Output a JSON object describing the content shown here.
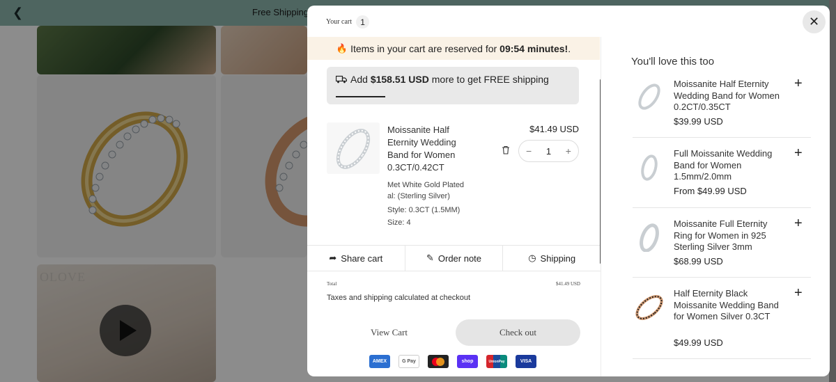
{
  "background": {
    "announcement": "Free Shipping",
    "watermark": "OLOVE"
  },
  "cart": {
    "title": "Your cart",
    "count": "1",
    "reserve_prefix": "Items in your cart are reserved for",
    "reserve_time": "09:54 minutes!",
    "reserve_suffix": ".",
    "shipping_prefix": "Add",
    "shipping_amount": "$158.51 USD",
    "shipping_suffix": "more to get FREE shipping",
    "shipping_progress_fraction": 0.21,
    "item": {
      "title": "Moissanite Half Eternity Wedding Band for Women 0.3CT/0.42CT",
      "options": [
        {
          "label": "Met White Gold Plated",
          "line2": "al:  (Sterling Silver)"
        },
        {
          "label": "Style:  0.3CT (1.5MM)"
        },
        {
          "label": "Size:  4"
        }
      ],
      "price": "$41.49 USD",
      "quantity": "1",
      "minus": "−",
      "plus": "+"
    },
    "actions": {
      "share": "Share cart",
      "note": "Order note",
      "shipping": "Shipping"
    },
    "total_label": "Total",
    "total_value": "$41.49 USD",
    "taxes_note": "Taxes and shipping calculated at checkout",
    "view_cart": "View Cart",
    "checkout": "Check out",
    "payments": [
      {
        "name": "AMEX",
        "color": "#2b6fd1"
      },
      {
        "name": "G Pay",
        "color": "#ffffff"
      },
      {
        "name": "MC",
        "color": "#222222"
      },
      {
        "name": "shop",
        "color": "#5a31f4"
      },
      {
        "name": "UnionPay",
        "color": "#d4252c"
      },
      {
        "name": "VISA",
        "color": "#1a3a9c"
      }
    ]
  },
  "recommendations": {
    "title": "You'll love this too",
    "items": [
      {
        "title": "Moissanite Half Eternity Wedding Band for Women 0.2CT/0.35CT",
        "price": "$39.99 USD",
        "metal": "silver"
      },
      {
        "title": "Full Moissanite Wedding Band for Women 1.5mm/2.0mm",
        "price": "From $49.99 USD",
        "metal": "silver"
      },
      {
        "title": "Moissanite Full Eternity Ring for Women in 925 Sterling Silver 3mm",
        "price": "$68.99 USD",
        "metal": "silver"
      },
      {
        "title": "Half Eternity Black Moissanite Wedding Band for Women Silver 0.3CT",
        "price": "$49.99 USD",
        "metal": "rose-black"
      }
    ]
  },
  "icons": {
    "back": "chevron-left-icon",
    "close": "close-icon",
    "fire": "fire-icon",
    "truck": "truck-icon",
    "trash": "trash-icon",
    "share": "share-icon",
    "note": "note-icon",
    "shipping": "clock-icon",
    "add": "plus-icon"
  }
}
